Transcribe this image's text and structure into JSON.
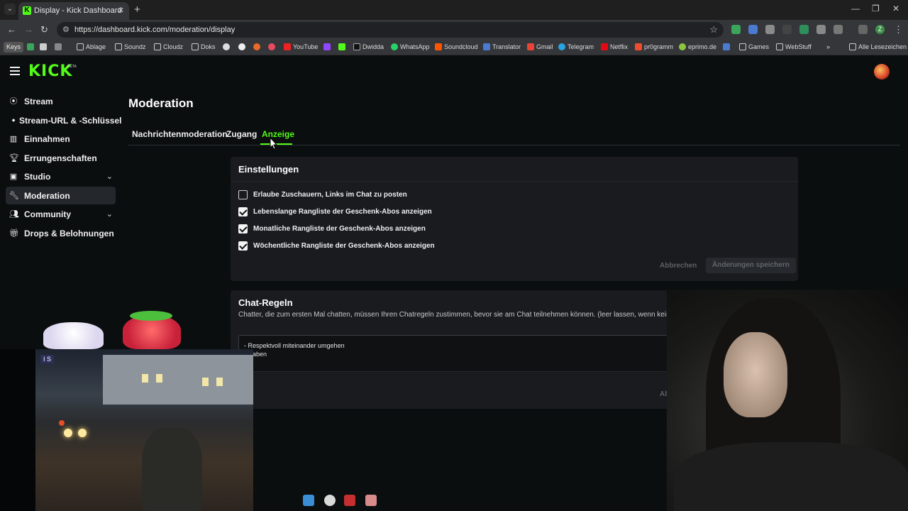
{
  "browser": {
    "tab_title": "Display - Kick Dashboard",
    "url": "https://dashboard.kick.com/moderation/display",
    "bookmarks": [
      {
        "label": "Keys"
      },
      {
        "label": "Ablage"
      },
      {
        "label": "Soundz"
      },
      {
        "label": "Cloudz"
      },
      {
        "label": "Doks"
      },
      {
        "label": "YouTube"
      },
      {
        "label": "Dwidda"
      },
      {
        "label": "WhatsApp"
      },
      {
        "label": "Soundcloud"
      },
      {
        "label": "Translator"
      },
      {
        "label": "Gmail"
      },
      {
        "label": "Telegram"
      },
      {
        "label": "Netflix"
      },
      {
        "label": "pr0gramm"
      },
      {
        "label": "eprimo.de"
      },
      {
        "label": "Games"
      },
      {
        "label": "WebStuff"
      },
      {
        "label": "Alle Lesezeichen"
      }
    ],
    "profile_initial": "Z"
  },
  "app": {
    "logo": "KICK",
    "logo_badge": "BETA"
  },
  "sidebar": {
    "items": [
      {
        "label": "Stream",
        "icon": "broadcast-icon"
      },
      {
        "label": "Stream-URL & -Schlüssel",
        "icon": "key-icon"
      },
      {
        "label": "Einnahmen",
        "icon": "chart-icon"
      },
      {
        "label": "Errungenschaften",
        "icon": "trophy-icon"
      },
      {
        "label": "Studio",
        "icon": "studio-icon"
      },
      {
        "label": "Moderation",
        "icon": "wrench-icon"
      },
      {
        "label": "Community",
        "icon": "users-icon"
      },
      {
        "label": "Drops & Belohnungen",
        "icon": "gift-icon"
      }
    ]
  },
  "main": {
    "title": "Moderation",
    "tabs": [
      {
        "label": "Nachrichtenmoderation"
      },
      {
        "label": "Zugang"
      },
      {
        "label": "Anzeige"
      }
    ],
    "settings": {
      "title": "Einstellungen",
      "options": [
        {
          "label": "Erlaube Zuschauern, Links im Chat zu posten",
          "checked": false
        },
        {
          "label": "Lebenslange Rangliste der Geschenk-Abos anzeigen",
          "checked": true
        },
        {
          "label": "Monatliche Rangliste der Geschenk-Abos anzeigen",
          "checked": true
        },
        {
          "label": "Wöchentliche Rangliste der Geschenk-Abos anzeigen",
          "checked": true
        }
      ],
      "cancel_label": "Abbrechen",
      "save_label": "Änderungen speichern"
    },
    "chat_rules": {
      "title": "Chat-Regeln",
      "description": "Chatter, die zum ersten Mal chatten, müssen Ihren Chatregeln zustimmen, bevor sie am Chat teilnehmen können. (leer lassen, wenn keine Regeln angezei",
      "line1": "- Respektvoll miteinander umgehen",
      "line2": "it haben",
      "cancel_label": "Abbrechen"
    }
  },
  "overlay": {
    "camera_badge": "I S"
  },
  "colors": {
    "accent": "#53fc18",
    "background": "#0b0e0f",
    "card": "#191b1f"
  }
}
